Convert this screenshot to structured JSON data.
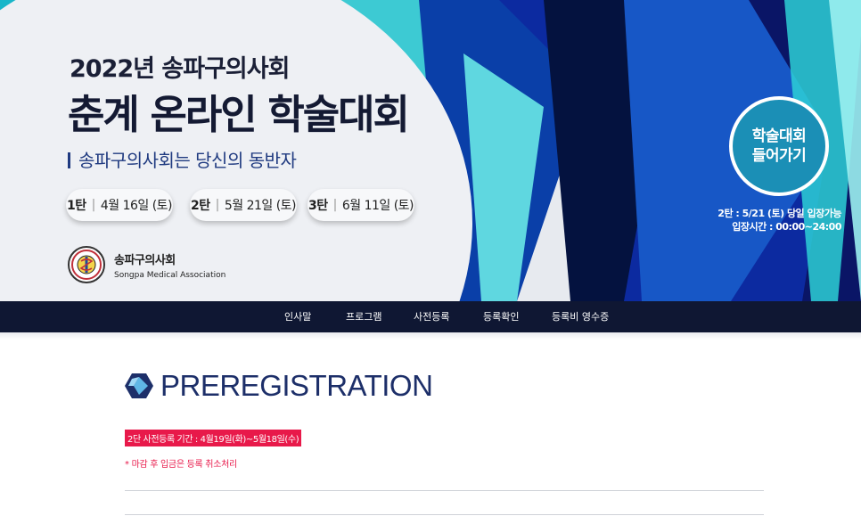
{
  "hero": {
    "subtitle": "2022년 송파구의사회",
    "title": "춘계 온라인 학술대회",
    "tagline": "송파구의사회는 당신의 동반자",
    "sessions": [
      {
        "num": "1탄",
        "date": "4월 16일 (토)"
      },
      {
        "num": "2탄",
        "date": "5월 21일 (토)"
      },
      {
        "num": "3탄",
        "date": "6월 11일 (토)"
      }
    ],
    "org_name": "송파구의사회",
    "org_name_en": "Songpa Medical Association",
    "enter_button": [
      "학술대회",
      "들어가기"
    ],
    "entry_info": [
      "2탄 : 5/21 (토) 당일 입장가능",
      "입장시간 : 00:00~24:00"
    ]
  },
  "nav": {
    "items": [
      "인사말",
      "프로그램",
      "사전등록",
      "등록확인",
      "등록비 영수증"
    ]
  },
  "content": {
    "section_title": "PREREGISTRATION",
    "period_notice": "2단 사전등록 기간 : 4월19일(화)~5월18일(수)",
    "note": "* 마감 후 입금은 등록 취소처리"
  },
  "colors": {
    "navy": "#0f1733",
    "accent_red": "#e8194a",
    "title_blue": "#1d2f69",
    "teal": "#1b8fb6"
  }
}
